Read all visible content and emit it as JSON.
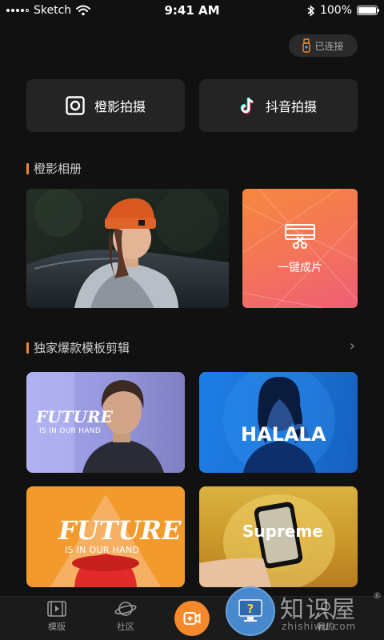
{
  "status_bar": {
    "carrier": "Sketch",
    "time": "9:41 AM",
    "battery_text": "100%",
    "battery_level": 1.0
  },
  "connection": {
    "label": "已连接",
    "icon": "device-icon"
  },
  "shoot_buttons": [
    {
      "label": "橙影拍摄",
      "icon": "camera-square-icon"
    },
    {
      "label": "抖音拍摄",
      "icon": "tiktok-icon"
    }
  ],
  "album_section": {
    "title": "橙影相册",
    "one_click_label": "一键成片"
  },
  "templates_section": {
    "title": "独家爆款模板剪辑",
    "templates": [
      {
        "title": "FUTURE",
        "subtitle": "IS IN OUR HAND"
      },
      {
        "title": "HALALA",
        "subtitle": ""
      },
      {
        "title": "FUTURE",
        "subtitle": "IS IN OUR HAND"
      },
      {
        "title": "Supreme",
        "subtitle": ""
      }
    ]
  },
  "tabbar": {
    "tabs": [
      {
        "label": "模版",
        "icon": "film-icon"
      },
      {
        "label": "社区",
        "icon": "planet-icon"
      },
      {
        "label": "我的",
        "icon": "profile-icon"
      }
    ],
    "center_icon": "record-icon"
  },
  "watermark": {
    "text": "知识屋",
    "url": "zhishiwu.com",
    "reg": "®"
  },
  "colors": {
    "accent": "#f6892b",
    "background": "#111111",
    "card": "#242424"
  }
}
